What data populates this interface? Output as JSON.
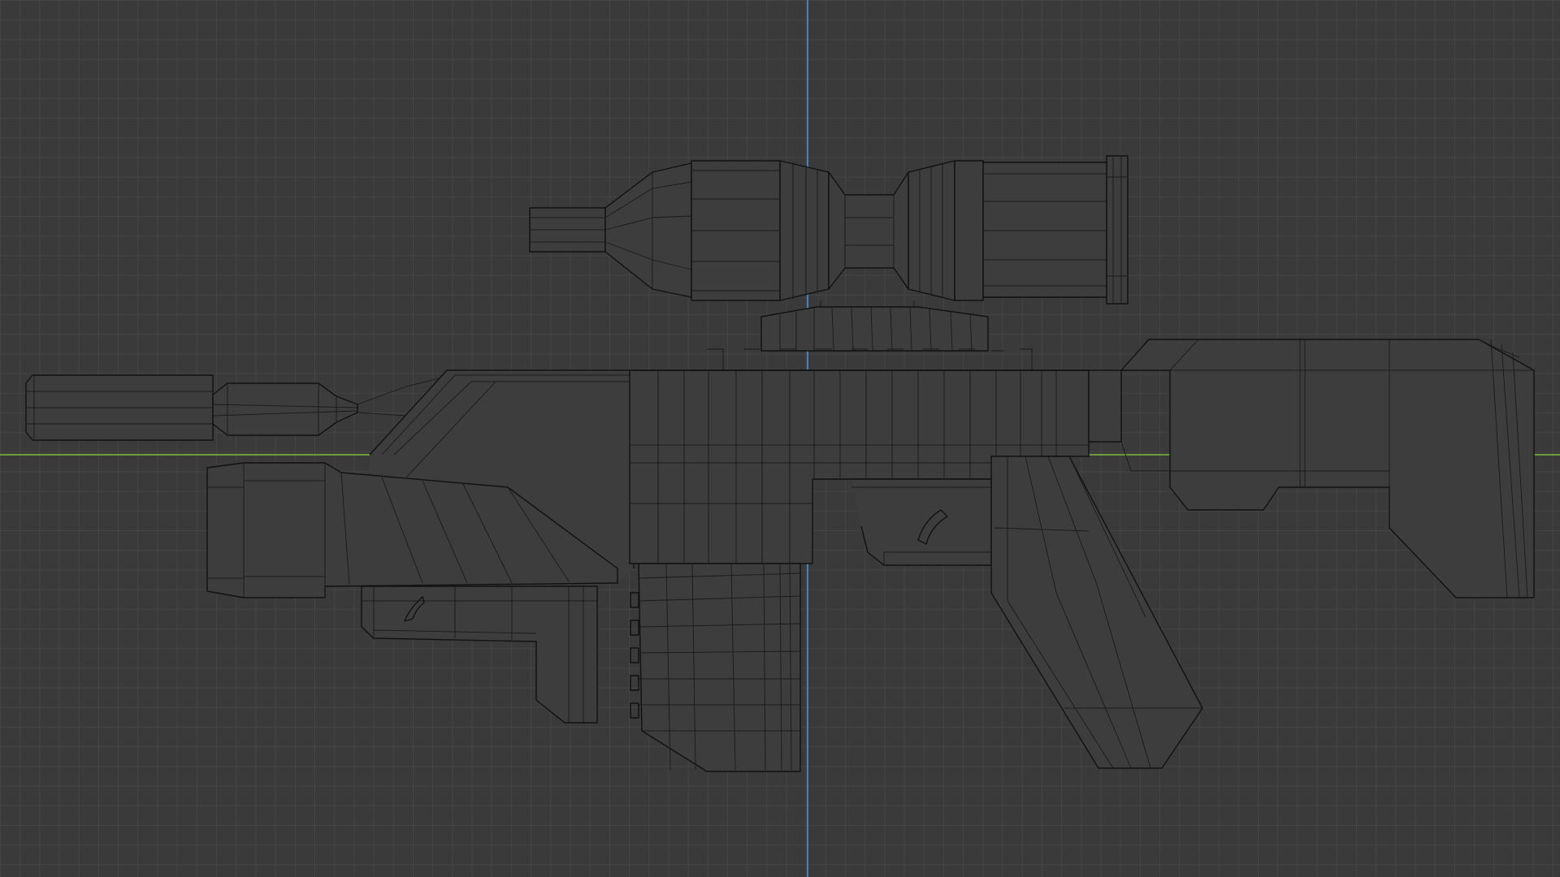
{
  "viewport": {
    "background_color": "#3a3a3a",
    "grid_color": "#444444",
    "x_axis_color": "#6d9a3a",
    "y_axis_color": "#4d7cb8",
    "view_mode": "wireframe",
    "object": "rifle-mesh"
  }
}
